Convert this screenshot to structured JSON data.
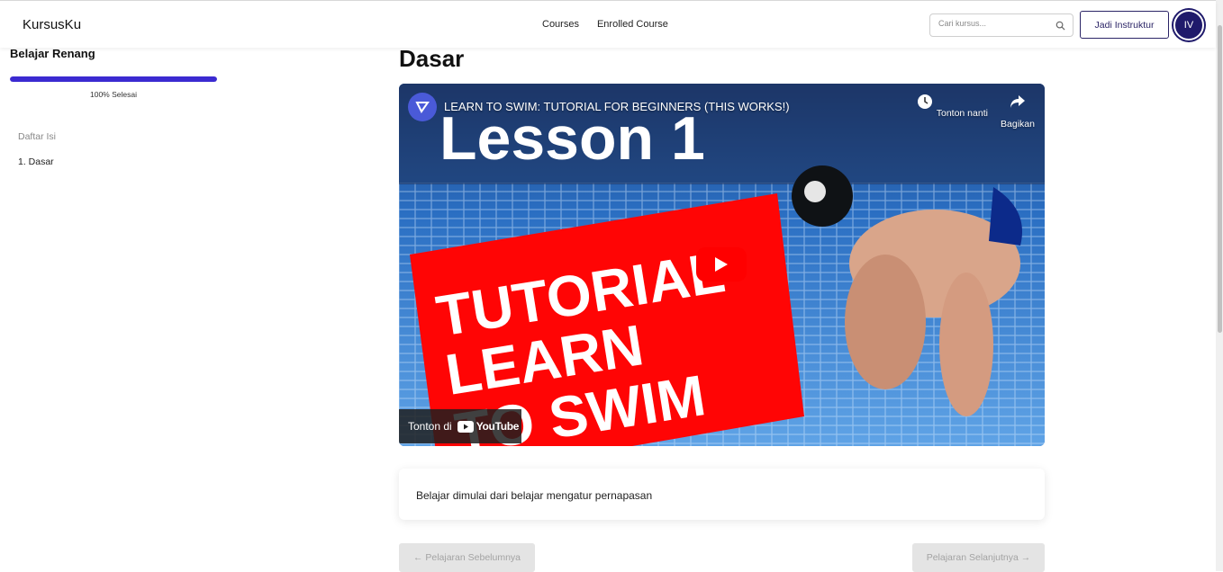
{
  "header": {
    "brand": "KursusKu",
    "nav": [
      "Courses",
      "Enrolled Course"
    ],
    "search_placeholder": "Cari kursus...",
    "instructor_button": "Jadi Instruktur",
    "avatar_initials": "IV"
  },
  "sidebar": {
    "course_title": "Belajar Renang",
    "progress_percent": 100,
    "progress_text": "100% Selesai",
    "toc_label": "Daftar Isi",
    "toc_items": [
      "1. Dasar"
    ]
  },
  "main": {
    "lesson_title": "Dasar",
    "video": {
      "title": "LEARN TO SWIM: TUTORIAL FOR BEGINNERS (THIS WORKS!)",
      "watch_later": "Tonton nanti",
      "share": "Bagikan",
      "watch_on": "Tonton di",
      "youtube": "YouTube",
      "thumbnail_lesson": "Lesson 1",
      "thumbnail_lines": [
        "TUTORIAL",
        "LEARN",
        "TO SWIM"
      ]
    },
    "description": "Belajar dimulai dari belajar mengatur pernapasan",
    "prev_button": "← Pelajaran Sebelumnya",
    "next_button": "Pelajaran Selanjutnya →"
  },
  "colors": {
    "accent": "#3b2ad1",
    "avatar": "#1f1a6b",
    "youtube_red": "#ff0000"
  }
}
